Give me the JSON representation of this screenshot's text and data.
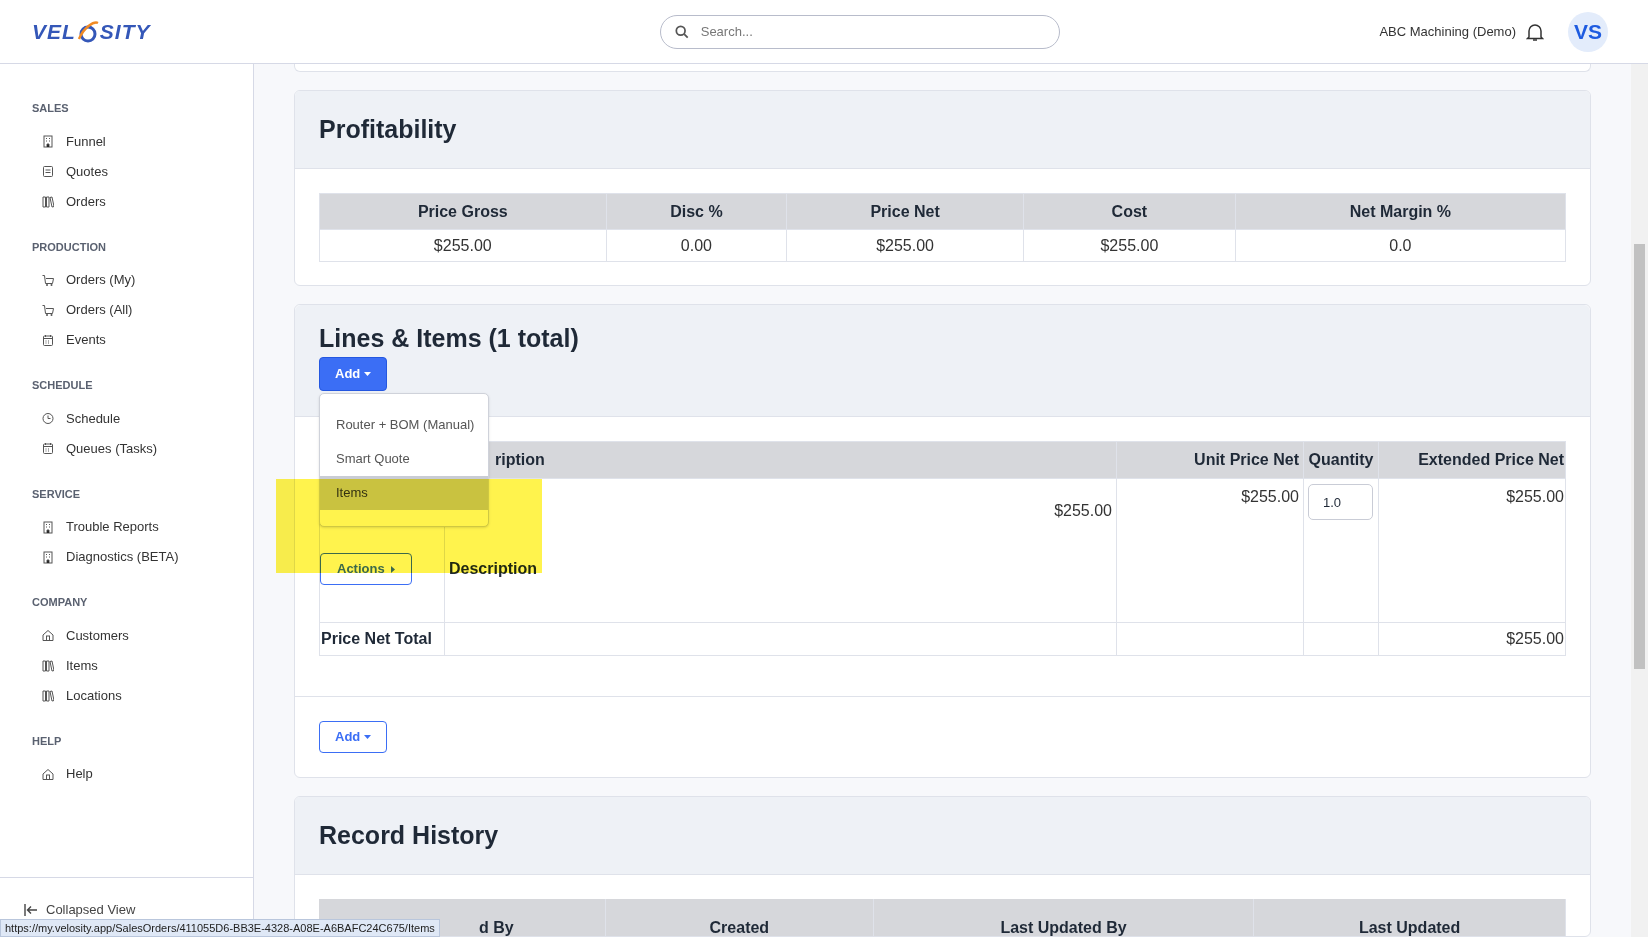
{
  "logo": {
    "left": "VEL",
    "right": "SITY"
  },
  "search": {
    "placeholder": "Search..."
  },
  "company": "ABC Machining (Demo)",
  "avatar": "VS",
  "sidebar": {
    "sections": [
      {
        "title": "SALES",
        "items": [
          {
            "label": "Funnel",
            "kind": "building"
          },
          {
            "label": "Quotes",
            "kind": "doc"
          },
          {
            "label": "Orders",
            "kind": "books"
          }
        ]
      },
      {
        "title": "PRODUCTION",
        "items": [
          {
            "label": "Orders (My)",
            "kind": "cart"
          },
          {
            "label": "Orders (All)",
            "kind": "cart"
          },
          {
            "label": "Events",
            "kind": "calendar"
          }
        ]
      },
      {
        "title": "SCHEDULE",
        "items": [
          {
            "label": "Schedule",
            "kind": "clock"
          },
          {
            "label": "Queues (Tasks)",
            "kind": "calendar"
          }
        ]
      },
      {
        "title": "SERVICE",
        "items": [
          {
            "label": "Trouble Reports",
            "kind": "building"
          },
          {
            "label": "Diagnostics (BETA)",
            "kind": "building"
          }
        ]
      },
      {
        "title": "COMPANY",
        "items": [
          {
            "label": "Customers",
            "kind": "home"
          },
          {
            "label": "Items",
            "kind": "books"
          },
          {
            "label": "Locations",
            "kind": "books"
          }
        ]
      },
      {
        "title": "HELP",
        "items": [
          {
            "label": "Help",
            "kind": "home"
          }
        ]
      }
    ],
    "footer": "Collapsed View"
  },
  "profitability": {
    "title": "Profitability",
    "columns": [
      "Price Gross",
      "Disc %",
      "Price Net",
      "Cost",
      "Net Margin %"
    ],
    "row": [
      "$255.00",
      "0.00",
      "$255.00",
      "$255.00",
      "0.0"
    ]
  },
  "lines": {
    "title": "Lines & Items (1 total)",
    "add_button": "Add",
    "menu": [
      {
        "label": "Router + BOM (Manual)",
        "selected": false
      },
      {
        "label": "Smart Quote",
        "selected": false
      },
      {
        "label": "Items",
        "selected": true
      }
    ],
    "columns": [
      "ription",
      "Unit Price Net",
      "Quantity",
      "Extended Price Net"
    ],
    "row": {
      "description_price": "$255.00",
      "actions": "Actions",
      "description_label": "Description",
      "unit_price": "$255.00",
      "quantity": "1.0",
      "extended": "$255.00"
    },
    "total": {
      "label": "Price Net Total",
      "extended": "$255.00"
    },
    "bottom_add": "Add"
  },
  "history": {
    "title": "Record History",
    "columns": [
      "d By",
      "Created",
      "Last Updated By",
      "Last Updated"
    ]
  },
  "status_url": "https://my.velosity.app/SalesOrders/411055D6-BB3E-4328-A08E-A6BAFC24C675/Items"
}
